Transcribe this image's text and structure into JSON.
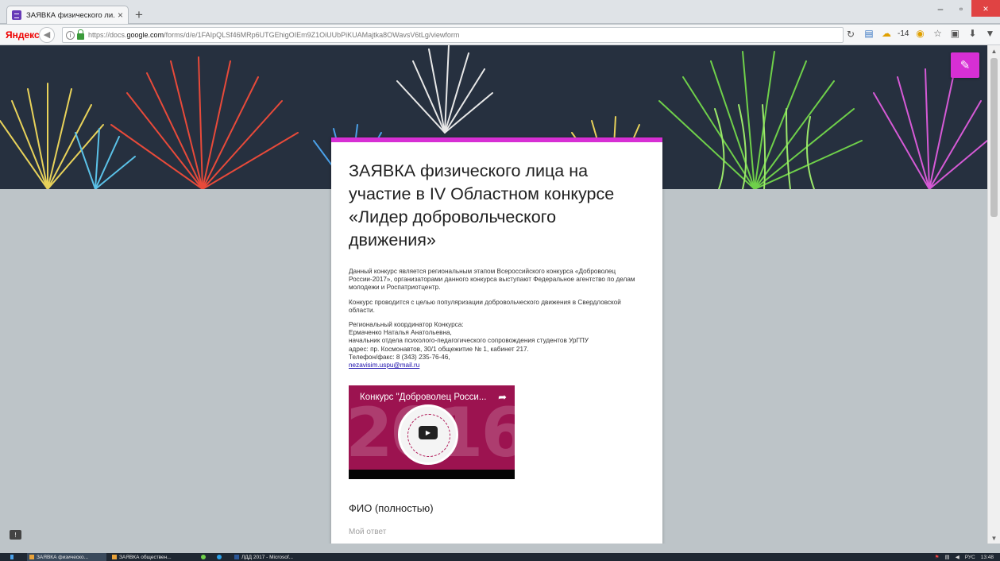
{
  "browser": {
    "tab_title": "ЗАЯВКА физического ли...",
    "new_tab_symbol": "+",
    "tab_close_symbol": "×",
    "brand": "Яндекс",
    "url_prefix": "https://docs.",
    "url_domain": "google.com",
    "url_path": "/forms/d/e/1FAIpQLSf46MRp6UTGEhigOIEm9Z1OiUUbPiKUAMajtka8OWavsV6tLg/viewform",
    "weather": "-14",
    "window_controls": {
      "minimize": "–",
      "maximize": "▫",
      "close": "×"
    }
  },
  "form": {
    "title": "ЗАЯВКА физического лица на участие в IV Областном конкурсе «Лидер добровольческого движения»",
    "description_1": "Данный конкурс является региональным этапом Всероссийского конкурса «Доброволец России-2017», организаторами данного конкурса выступают Федеральное агентство по делам молодежи и Роспатриотцентр.",
    "description_2": "Конкурс проводится с целью популяризации добровольческого движения в Свердловской области.",
    "coordinator_lines": [
      "Региональный координатор Конкурса:",
      "Ермаченко Наталья Анатольевна,",
      "начальник отдела психолого-педагогического сопровождения студентов УрГПУ",
      "адрес: пр. Космонавтов, 30/1 общежитие № 1, кабинет 217.",
      "Телефон/факс: 8 (343) 235-76-46,"
    ],
    "email": "nezavisim.uspu@mail.ru",
    "video_title": "Конкурс \"Доброволец Росси...",
    "video_bg_text": "2016",
    "question_label": "ФИО (полностью)",
    "answer_placeholder": "Мой ответ"
  },
  "taskbar": {
    "items": [
      {
        "label": "ЗАЯВКА физическо..."
      },
      {
        "label": "ЗАЯВКА обществен..."
      },
      {
        "label": ""
      },
      {
        "label": ""
      },
      {
        "label": "ЛДД 2017 - Microsof..."
      }
    ],
    "language": "РУС",
    "time": "13:48"
  },
  "colors": {
    "accent": "#d72fd4",
    "page_bg": "#bdc4c8",
    "header_bg": "#26303f",
    "link": "#1a0dab",
    "video_bg": "#9c1350"
  },
  "icons": {
    "edit": "pencil-icon",
    "feedback": "feedback-icon",
    "video_share": "share-icon",
    "video_play": "play-icon"
  }
}
